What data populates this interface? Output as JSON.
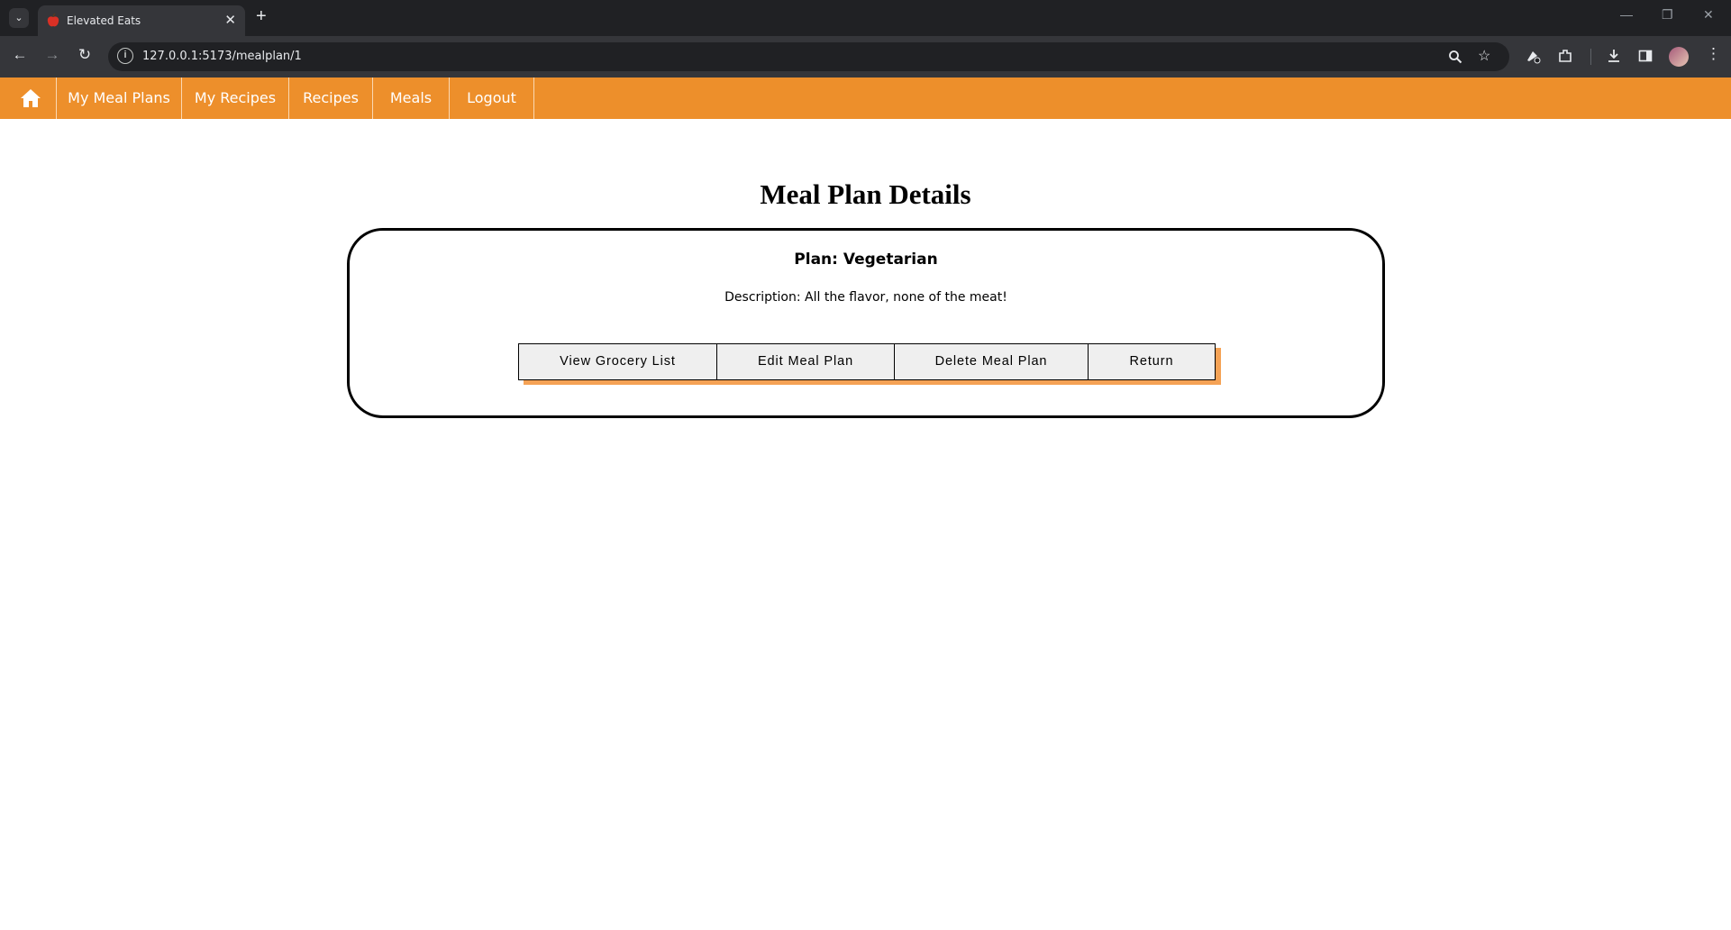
{
  "browser": {
    "tab_title": "Elevated Eats",
    "url": "127.0.0.1:5173/mealplan/1",
    "icons": [
      "tab-list-icon",
      "close-icon",
      "new-tab-icon",
      "minimize-icon",
      "restore-icon",
      "window-close-icon",
      "back-icon",
      "forward-icon",
      "reload-icon",
      "site-info-icon",
      "zoom-icon",
      "bookmark-star-icon",
      "extension-pin-icon",
      "extensions-icon",
      "download-icon",
      "side-panel-icon",
      "profile-avatar",
      "menu-icon"
    ]
  },
  "nav": {
    "home_icon": "home-icon",
    "items": [
      "My Meal Plans",
      "My Recipes",
      "Recipes",
      "Meals",
      "Logout"
    ],
    "accent_color": "#ed8f2b"
  },
  "page": {
    "title": "Meal Plan Details",
    "plan_name": "Plan: Vegetarian",
    "description": "Description: All the flavor, none of the meat!",
    "buttons": [
      "View Grocery List",
      "Edit Meal Plan",
      "Delete Meal Plan",
      "Return"
    ],
    "button_shadow_color": "#f5a255"
  }
}
